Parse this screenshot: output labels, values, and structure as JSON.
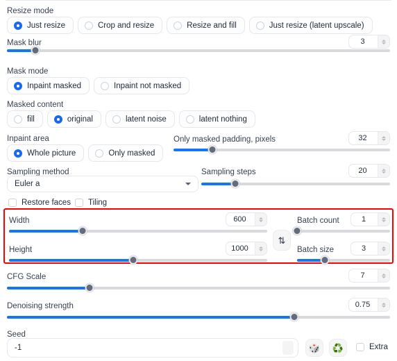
{
  "resize_mode": {
    "label": "Resize mode",
    "options": [
      {
        "label": "Just resize",
        "selected": true
      },
      {
        "label": "Crop and resize",
        "selected": false
      },
      {
        "label": "Resize and fill",
        "selected": false
      },
      {
        "label": "Just resize (latent upscale)",
        "selected": false
      }
    ]
  },
  "mask_blur": {
    "label": "Mask blur",
    "value": "3",
    "fill_pct": 7.5,
    "thumb_pct": 7.5
  },
  "mask_mode": {
    "label": "Mask mode",
    "options": [
      {
        "label": "Inpaint masked",
        "selected": true
      },
      {
        "label": "Inpaint not masked",
        "selected": false
      }
    ]
  },
  "masked_content": {
    "label": "Masked content",
    "options": [
      {
        "label": "fill",
        "selected": false
      },
      {
        "label": "original",
        "selected": true
      },
      {
        "label": "latent noise",
        "selected": false
      },
      {
        "label": "latent nothing",
        "selected": false
      }
    ]
  },
  "inpaint_area": {
    "label": "Inpaint area",
    "options": [
      {
        "label": "Whole picture",
        "selected": true
      },
      {
        "label": "Only masked",
        "selected": false
      }
    ]
  },
  "only_masked_padding": {
    "label": "Only masked padding, pixels",
    "value": "32",
    "fill_pct": 18,
    "thumb_pct": 18
  },
  "sampling_method": {
    "label": "Sampling method",
    "value": "Euler a"
  },
  "sampling_steps": {
    "label": "Sampling steps",
    "value": "20",
    "fill_pct": 18,
    "thumb_pct": 18
  },
  "restore_faces": {
    "label": "Restore faces",
    "checked": false
  },
  "tiling": {
    "label": "Tiling",
    "checked": false
  },
  "width": {
    "label": "Width",
    "value": "600",
    "fill_pct": 28.5,
    "thumb_pct": 28.5
  },
  "height": {
    "label": "Height",
    "value": "1000",
    "fill_pct": 48,
    "thumb_pct": 48
  },
  "batch_count": {
    "label": "Batch count",
    "value": "1",
    "fill_pct": 0,
    "thumb_pct": 0
  },
  "batch_size": {
    "label": "Batch size",
    "value": "3",
    "fill_pct": 30,
    "thumb_pct": 30
  },
  "swap_button": {
    "glyph": "⇅",
    "title": "Swap width and height"
  },
  "cfg_scale": {
    "label": "CFG Scale",
    "value": "7",
    "fill_pct": 21.5,
    "thumb_pct": 21.5
  },
  "denoising_strength": {
    "label": "Denoising strength",
    "value": "0.75",
    "fill_pct": 75,
    "thumb_pct": 75
  },
  "seed": {
    "label": "Seed",
    "value": "-1"
  },
  "seed_buttons": [
    {
      "glyph": "🎲",
      "name": "random-seed-button"
    },
    {
      "glyph": "♻️",
      "name": "reuse-seed-button"
    }
  ],
  "extra": {
    "label": "Extra",
    "checked": false
  },
  "highlight": {
    "color": "#ff0000"
  }
}
